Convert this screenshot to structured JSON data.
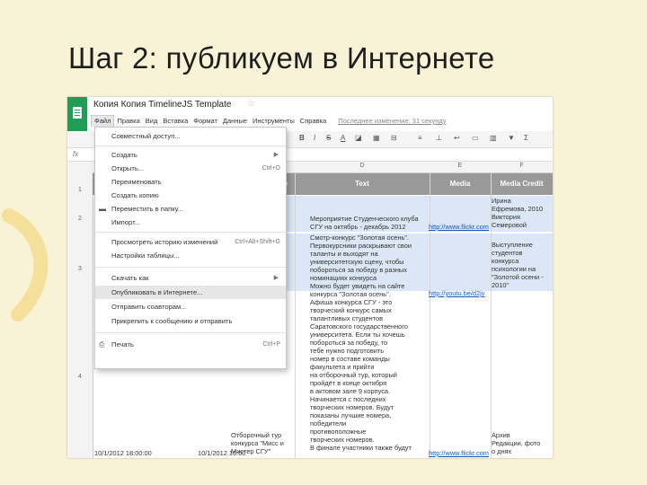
{
  "slide_title": "Шаг 2: публикуем в Интернете",
  "doc_title": "Копия Копия TimelineJS Template",
  "menubar": [
    "Файл",
    "Правка",
    "Вид",
    "Вставка",
    "Формат",
    "Данные",
    "Инструменты",
    "Справка"
  ],
  "last_edit": "Последнее изменение: 31 секунду",
  "file_menu": {
    "share": "Совместный доступ...",
    "create": "Создать",
    "open": "Открыть...",
    "open_shortcut": "Ctrl+O",
    "rename": "Переименовать",
    "copy": "Создать копию",
    "move": "Переместить в папку...",
    "import": "Импорт...",
    "history": "Просмотреть историю изменений",
    "history_shortcut": "Ctrl+Alt+Shift+G",
    "settings": "Настройки таблицы...",
    "download": "Скачать как",
    "publish": "Опубликовать в Интернете...",
    "email_collab": "Отправить соавторам...",
    "email_attach": "Прикрепить к сообщению и отправить",
    "print": "Печать",
    "print_shortcut": "Ctrl+P"
  },
  "col_letters": [
    "D",
    "E",
    "F"
  ],
  "row_numbers": [
    "1",
    "2",
    "3",
    "4"
  ],
  "headers": {
    "text": "Text",
    "media": "Media",
    "credit": "Media Credit",
    "c_partial": "e"
  },
  "cells": {
    "d2": "Мероприятие Студенческого клуба\nСГУ на октябрь - декабрь 2012\nСмотр конкурс \"Золотая осень\"",
    "d3": "Смотр-конкурс \"Золотая осень\".\nПервокурсники раскрывают свои\nталанты и выходят на\nуниверситетскую сцену, чтобы\nпобороться за победу в разных\nноминациях конкурса\nМожно будет увидеть на сайте\nконкурса \"Золотая осень\".\nАфиша конкурса СГУ - это\nтворческий конкурс самых\nталантливых студентов\nСаратовского государственного\nуниверситета. Если ты хочешь\nпобороться за победу, то\nтебе нужно подготовить\nномер в составе команды\nфакультета и прийти\nна отборочный тур, который\nпройдёт в конце октября\nв актовом зале 9 корпуса.\nНачинается с последних\nтворческих номеров. Будут\nпоказаны лучшие номера,\nпобедители\nпротивоположные\nтворческих номеров.\nВ финале участники также будут\nинтеллектуальные игры\nзнание.",
    "e2": "http://www.flickr.com",
    "e3": "http://youtu.be/d2jv",
    "e5": "http://www.flickr.com",
    "f2": "Ирина\nЕфремова, 2010\nВиктория\nСемеровой",
    "f3": "Выступление\nстудентов\nконкурса\nпсихологии на\n\"Золотой осени -\n2010\"",
    "f5": "Архив\nРедакции, фото\nо днях",
    "c5": "Отборочный тур\nконкурса \"Мисс и\nМистер СГУ\"",
    "a5": "10/1/2012 18:00:00",
    "b5": "10/1/2012 16:00"
  },
  "colors": {
    "accent_green": "#1f9c56",
    "header_gray": "#999999",
    "selection_blue": "#dbe7f6",
    "background": "#f8f2d6"
  }
}
